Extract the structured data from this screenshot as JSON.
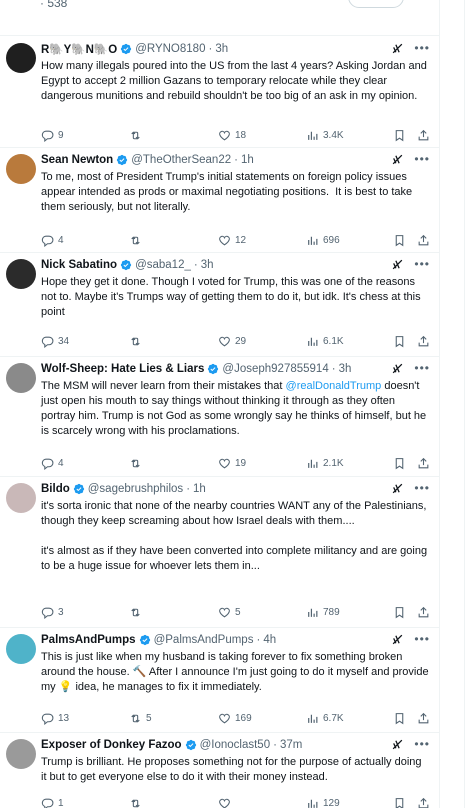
{
  "top": {
    "count": "· 538"
  },
  "tweets": [
    {
      "name": "R🐘Y🐘N🐘O",
      "handle": "@RYNO8180",
      "time": "3h",
      "text": "How many illegals poured into the US from the last 4 years? Asking Jordan and Egypt to accept 2 million Gazans to temporary relocate while they clear dangerous munitions and rebuild shouldn't be too big of an ask in my opinion.",
      "replies": "9",
      "retweets": "",
      "likes": "18",
      "views": "3.4K",
      "avatar_color": "#1f1f1f"
    },
    {
      "name": "Sean Newton",
      "handle": "@TheOtherSean22",
      "time": "1h",
      "text": "To me, most of President Trump's initial statements on foreign policy issues appear intended as prods or maximal negotiating positions.  It is best to take them seriously, but not literally.",
      "replies": "4",
      "retweets": "",
      "likes": "12",
      "views": "696",
      "avatar_color": "#b97a3c"
    },
    {
      "name": "Nick Sabatino",
      "handle": "@saba12_",
      "time": "3h",
      "text": "Hope they get it done. Though I voted for Trump, this was one of the reasons not to. Maybe it's Trumps way of getting them to do it, but idk. It's chess at this point",
      "replies": "34",
      "retweets": "",
      "likes": "29",
      "views": "6.1K",
      "avatar_color": "#2b2b2b"
    },
    {
      "name": "Wolf-Sheep: Hate Lies & Liars",
      "handle": "@Joseph927855914",
      "time": "3h",
      "text_pre": "The MSM will never learn from their mistakes that ",
      "mention": "@realDonaldTrump",
      "text_post": " doesn't just open his mouth to say things without thinking it through as they often portray him. Trump is not God as some wrongly say he thinks of himself, but he is scarcely wrong with his proclamations.",
      "replies": "4",
      "retweets": "",
      "likes": "19",
      "views": "2.1K",
      "avatar_color": "#8a8a8a"
    },
    {
      "name": "Bildo",
      "handle": "@sagebrushphilos",
      "time": "1h",
      "text": "it's sorta ironic that none of the nearby countries WANT any of the Palestinians, though they keep screaming about how Israel deals with them....\n\nit's almost as if they have been converted into complete militancy and are going to be a huge issue for whoever lets them in...",
      "replies": "3",
      "retweets": "",
      "likes": "5",
      "views": "789",
      "avatar_color": "#c9b8b8"
    },
    {
      "name": "PalmsAndPumps",
      "handle": "@PalmsAndPumps",
      "time": "4h",
      "text": "This is just like when my husband is taking forever to fix something broken around the house. 🔨 After I announce I'm just going to do it myself and provide my 💡 idea, he manages to fix it immediately.",
      "replies": "13",
      "retweets": "5",
      "likes": "169",
      "views": "6.7K",
      "avatar_color": "#4fb3c9"
    },
    {
      "name": "Exposer of Donkey Fazoo",
      "handle": "@Ionoclast50",
      "time": "37m",
      "text": "Trump is brilliant. He proposes something not for the purpose of actually doing it but to get everyone else to do it with their money instead.",
      "replies": "1",
      "retweets": "",
      "likes": "",
      "views": "129",
      "avatar_color": "#9a9a9a"
    }
  ],
  "colors": {
    "verified": "#1d9bf0",
    "secondary": "#536471",
    "divider": "#eff3f4"
  }
}
